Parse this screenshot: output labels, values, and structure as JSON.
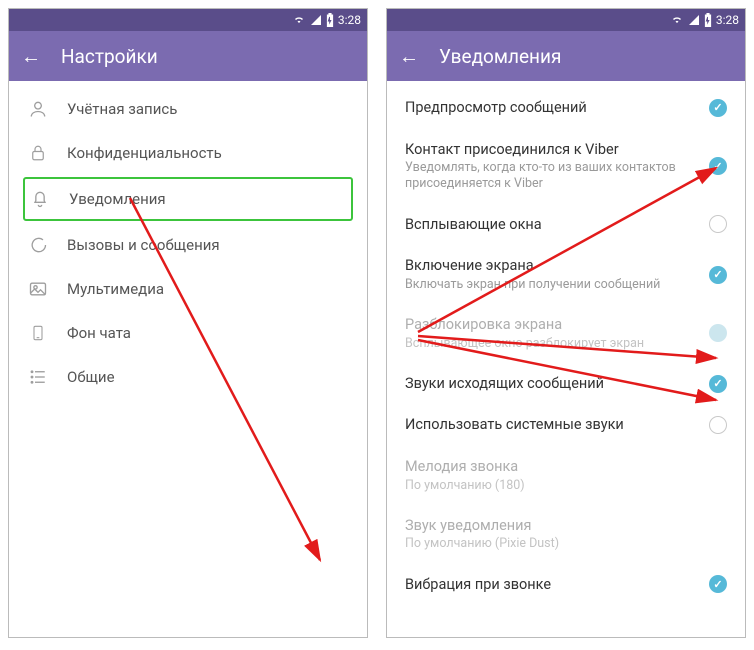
{
  "status": {
    "time": "3:28"
  },
  "left": {
    "title": "Настройки",
    "items": [
      {
        "label": "Учётная запись"
      },
      {
        "label": "Конфиденциальность"
      },
      {
        "label": "Уведомления"
      },
      {
        "label": "Вызовы и сообщения"
      },
      {
        "label": "Мультимедиа"
      },
      {
        "label": "Фон чата"
      },
      {
        "label": "Общие"
      }
    ]
  },
  "right": {
    "title": "Уведомления",
    "settings": [
      {
        "title": "Предпросмотр сообщений",
        "sub": "",
        "state": "on"
      },
      {
        "title": "Контакт присоединился к Viber",
        "sub": "Уведомлять, когда кто-то из ваших контактов присоединяется к Viber",
        "state": "on"
      },
      {
        "title": "Всплывающие окна",
        "sub": "",
        "state": "off"
      },
      {
        "title": "Включение экрана",
        "sub": "Включать экран при получении сообщений",
        "state": "on"
      },
      {
        "title": "Разблокировка экрана",
        "sub": "Всплывающее окно разблокирует экран",
        "state": "off-disabled",
        "disabled": true
      },
      {
        "title": "Звуки исходящих сообщений",
        "sub": "",
        "state": "on"
      },
      {
        "title": "Использовать системные звуки",
        "sub": "",
        "state": "off"
      },
      {
        "title": "Мелодия звонка",
        "sub": "По умолчанию (180)",
        "state": "",
        "disabled": true
      },
      {
        "title": "Звук уведомления",
        "sub": "По умолчанию (Pixie Dust)",
        "state": "",
        "disabled": true
      },
      {
        "title": "Вибрация при звонке",
        "sub": "",
        "state": "on"
      }
    ]
  }
}
